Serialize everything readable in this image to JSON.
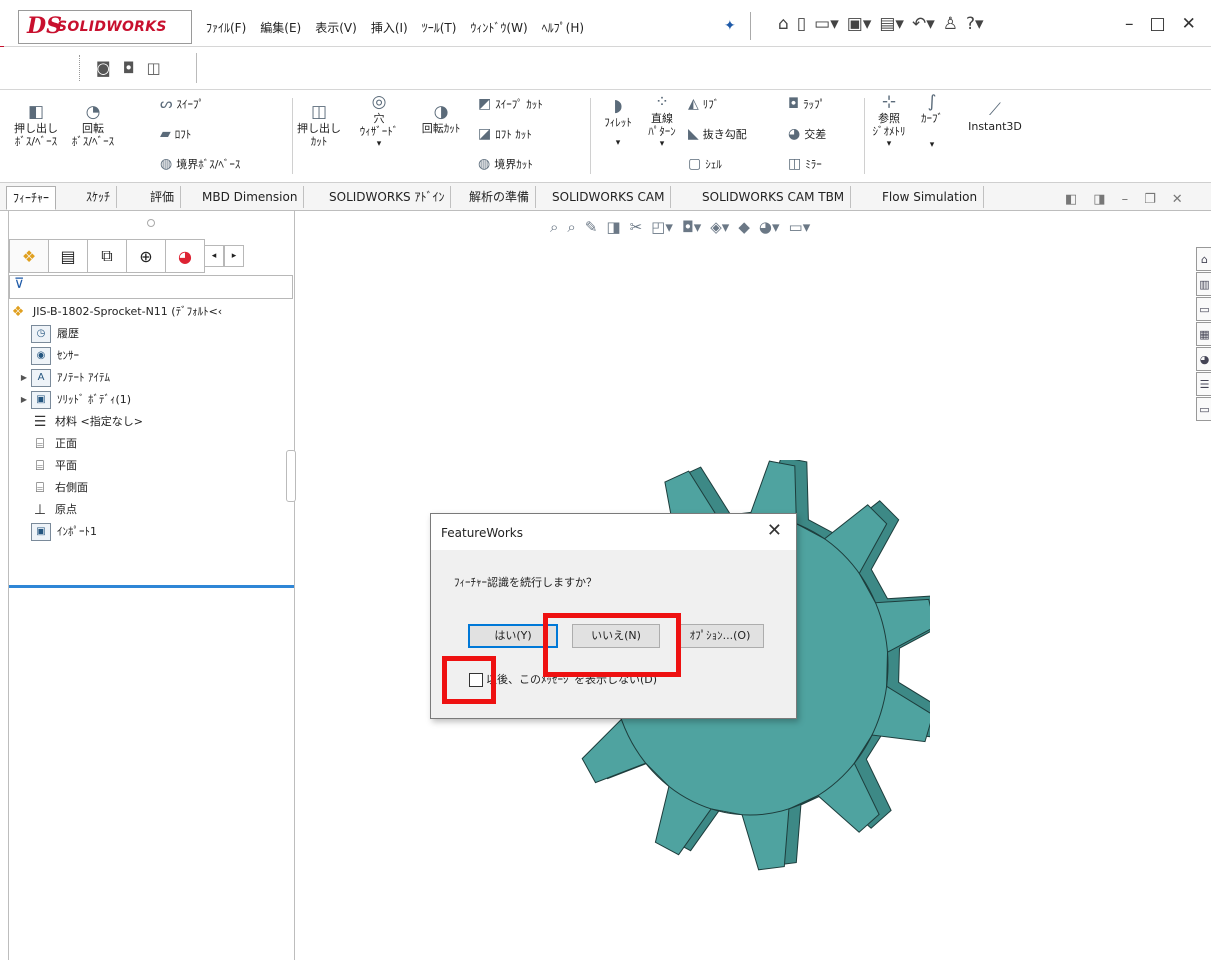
{
  "app": {
    "logo_ds": "DS",
    "logo_text": "SOLIDWORKS"
  },
  "menu": {
    "items": [
      "ﾌｧｲﾙ(F)",
      "編集(E)",
      "表示(V)",
      "挿入(I)",
      "ﾂｰﾙ(T)",
      "ｳｨﾝﾄﾞｳ(W)",
      "ﾍﾙﾌﾟ(H)"
    ]
  },
  "toolbar": {
    "extrude_boss": "押し出し\nﾎﾞｽ/ﾍﾞｰｽ",
    "revolve_boss": "回転\nﾎﾞｽ/ﾍﾞｰｽ",
    "sweep": "ｽｲｰﾌﾟ",
    "loft": "ﾛﾌﾄ",
    "boundary_boss": "境界ﾎﾞｽ/ﾍﾞｰｽ",
    "extruded_cut": "押し出し\nｶｯﾄ",
    "hole_wizard": "穴\nｳｨｻﾞｰﾄﾞ",
    "revolved_cut": "回転ｶｯﾄ",
    "swept_cut": "ｽｲｰﾌﾟ ｶｯﾄ",
    "lofted_cut": "ﾛﾌﾄ ｶｯﾄ",
    "boundary_cut": "境界ｶｯﾄ",
    "fillet": "ﾌｨﾚｯﾄ",
    "linear_pattern": "直線\nﾊﾟﾀｰﾝ",
    "rib": "ﾘﾌﾞ",
    "draft": "抜き勾配",
    "shell": "ｼｪﾙ",
    "wrap": "ﾗｯﾌﾟ",
    "intersect": "交差",
    "mirror": "ﾐﾗｰ",
    "ref_geometry": "参照\nｼﾞｵﾒﾄﾘ",
    "curves": "ｶｰﾌﾞ",
    "instant3d": "Instant3D"
  },
  "tabs": [
    "ﾌｨｰﾁｬｰ",
    "ｽｹｯﾁ",
    "評価",
    "MBD Dimension",
    "SOLIDWORKS ｱﾄﾞｲﾝ",
    "解析の準備",
    "SOLIDWORKS CAM",
    "SOLIDWORKS CAM TBM",
    "Flow Simulation"
  ],
  "tree": {
    "part_name": "JIS-B-1802-Sprocket-N11 (ﾃﾞﾌｫﾙﾄ<‹",
    "items": [
      "履歴",
      "ｾﾝｻｰ",
      "ｱﾉﾃｰﾄ ｱｲﾃﾑ",
      "ｿﾘｯﾄﾞ ﾎﾞﾃﾞｨ(1)",
      "材料 <指定なし>",
      "正面",
      "平面",
      "右側面",
      "原点",
      "ｲﾝﾎﾟｰﾄ1"
    ]
  },
  "dialog": {
    "title": "FeatureWorks",
    "message": "ﾌｨｰﾁｬｰ認識を続行しますか？",
    "yes": "はい(Y)",
    "no": "いいえ(N)",
    "options": "ｵﾌﾟｼｮﾝ...(O)",
    "checkbox_label": "以後、このﾒｯｾｰｼﾞを表示しない(D)",
    "checkbox_checked": false
  },
  "colors": {
    "brand_red": "#c8102e",
    "gear_fill": "#4fa3a0",
    "gear_edge": "#1d3d3c",
    "highlight_red": "#ee1111",
    "selection_blue": "#2f86d6"
  }
}
